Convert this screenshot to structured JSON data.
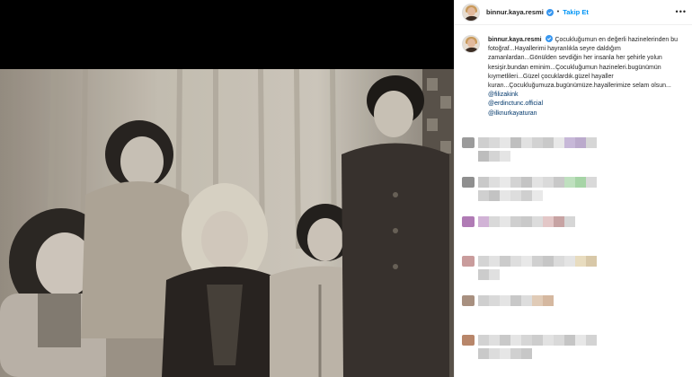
{
  "post": {
    "username": "binnur.kaya.resmi",
    "separator": "•",
    "follow_label": "Takip Et",
    "more_label": "•••",
    "caption_text": "Çocukluğumun en değerli hazinelerinden bu fotoğraf...Hayallerimi hayranlıkla seyre daldığım zamanlardan...Gönülden sevdiğin her insanla her şehirle yolun kesişir.bundan eminim...Çocukluğumun hazineleri.bugünümün kıymetlileri...Güzel çocuklardık.güzel hayaller kuran...Çocukluğumuza.bugünümüze.hayallerimize selam olsun...",
    "mentions": [
      "@filizakink",
      "@erdinctunc.official",
      "@ilknurkayaturan"
    ]
  },
  "colors": {
    "accent": "#0095f6",
    "verified": "#3897f0",
    "mention": "#00376b"
  },
  "comments": [
    {
      "avatar": "#9b9b9b",
      "row1": [
        "#cfcfcf",
        "#d9d9d9",
        "#e6e6e6",
        "#bfbfbf",
        "#e1e1e1",
        "#d2d2d2",
        "#c9c9c9",
        "#e8e8e8",
        "#c7b8d8",
        "#bbaacc",
        "#d6d6d6"
      ],
      "row2": [
        "#bdbdbd",
        "#d4d4d4",
        "#e4e4e4"
      ]
    },
    {
      "avatar": "#8f8f8f",
      "row1": [
        "#c9c9c9",
        "#dedede",
        "#e9e9e9",
        "#d3d3d3",
        "#c4c4c4",
        "#e3e3e3",
        "#dadada",
        "#c8c8c8",
        "#bfe0bf",
        "#a6d4a6",
        "#d9d9d9"
      ],
      "row2": [
        "#d0d0d0",
        "#c3c3c3",
        "#e6e6e6",
        "#dddddd",
        "#cfcfcf",
        "#e9e9e9"
      ]
    },
    {
      "avatar": "#b07bb5",
      "row1": [
        "#d1b3d6",
        "#d9d9d9",
        "#e6e6e6",
        "#cfcfcf",
        "#c9c9c9",
        "#dcdcdc",
        "#e3c7c7",
        "#c7a3a3",
        "#d6d6d6"
      ],
      "row2": []
    },
    {
      "avatar": "#c99c9c",
      "row1": [
        "#d4d4d4",
        "#e2e2e2",
        "#cbcbcb",
        "#dedede",
        "#e8e8e8",
        "#d0d0d0",
        "#c6c6c6",
        "#dbdbdb",
        "#e4e4e4",
        "#e8dcbf",
        "#d8c8a8"
      ],
      "row2": [
        "#cccccc",
        "#e0e0e0"
      ]
    },
    {
      "avatar": "#a89080",
      "row1": [
        "#cfcfcf",
        "#d9d9d9",
        "#e4e4e4",
        "#c8c8c8",
        "#dddddd",
        "#e0cbb7",
        "#d5b8a0"
      ],
      "row2": []
    },
    {
      "avatar": "#b8866a",
      "row1": [
        "#d2d2d2",
        "#dfdfdf",
        "#c9c9c9",
        "#e5e5e5",
        "#d6d6d6",
        "#cdcdcd",
        "#e2e2e2",
        "#d9d9d9",
        "#c5c5c5",
        "#e7e7e7",
        "#d3d3d3"
      ],
      "row2": [
        "#c9c9c9",
        "#dcdcdc",
        "#e6e6e6",
        "#d0d0d0",
        "#c7c7c7"
      ]
    }
  ]
}
